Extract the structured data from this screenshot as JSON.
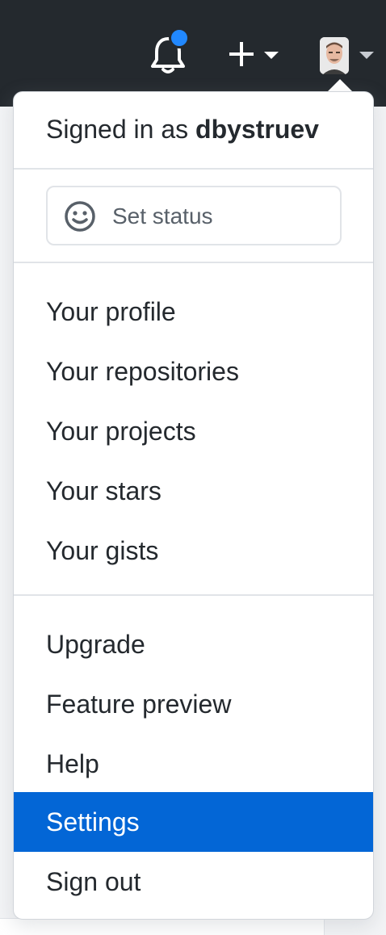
{
  "header": {
    "notifications_icon": "bell-icon",
    "notification_dot_color": "#2188ff",
    "create_icon": "plus-icon",
    "avatar_icon": "avatar"
  },
  "dropdown": {
    "signed_in_prefix": "Signed in as",
    "username": "dbystruev",
    "set_status": {
      "label": "Set status",
      "icon": "smiley-icon"
    },
    "section1": [
      {
        "label": "Your profile"
      },
      {
        "label": "Your repositories"
      },
      {
        "label": "Your projects"
      },
      {
        "label": "Your stars"
      },
      {
        "label": "Your gists"
      }
    ],
    "section2": [
      {
        "label": "Upgrade"
      },
      {
        "label": "Feature preview"
      },
      {
        "label": "Help"
      },
      {
        "label": "Settings",
        "active": true
      },
      {
        "label": "Sign out"
      }
    ],
    "active_color": "#0366d6"
  }
}
